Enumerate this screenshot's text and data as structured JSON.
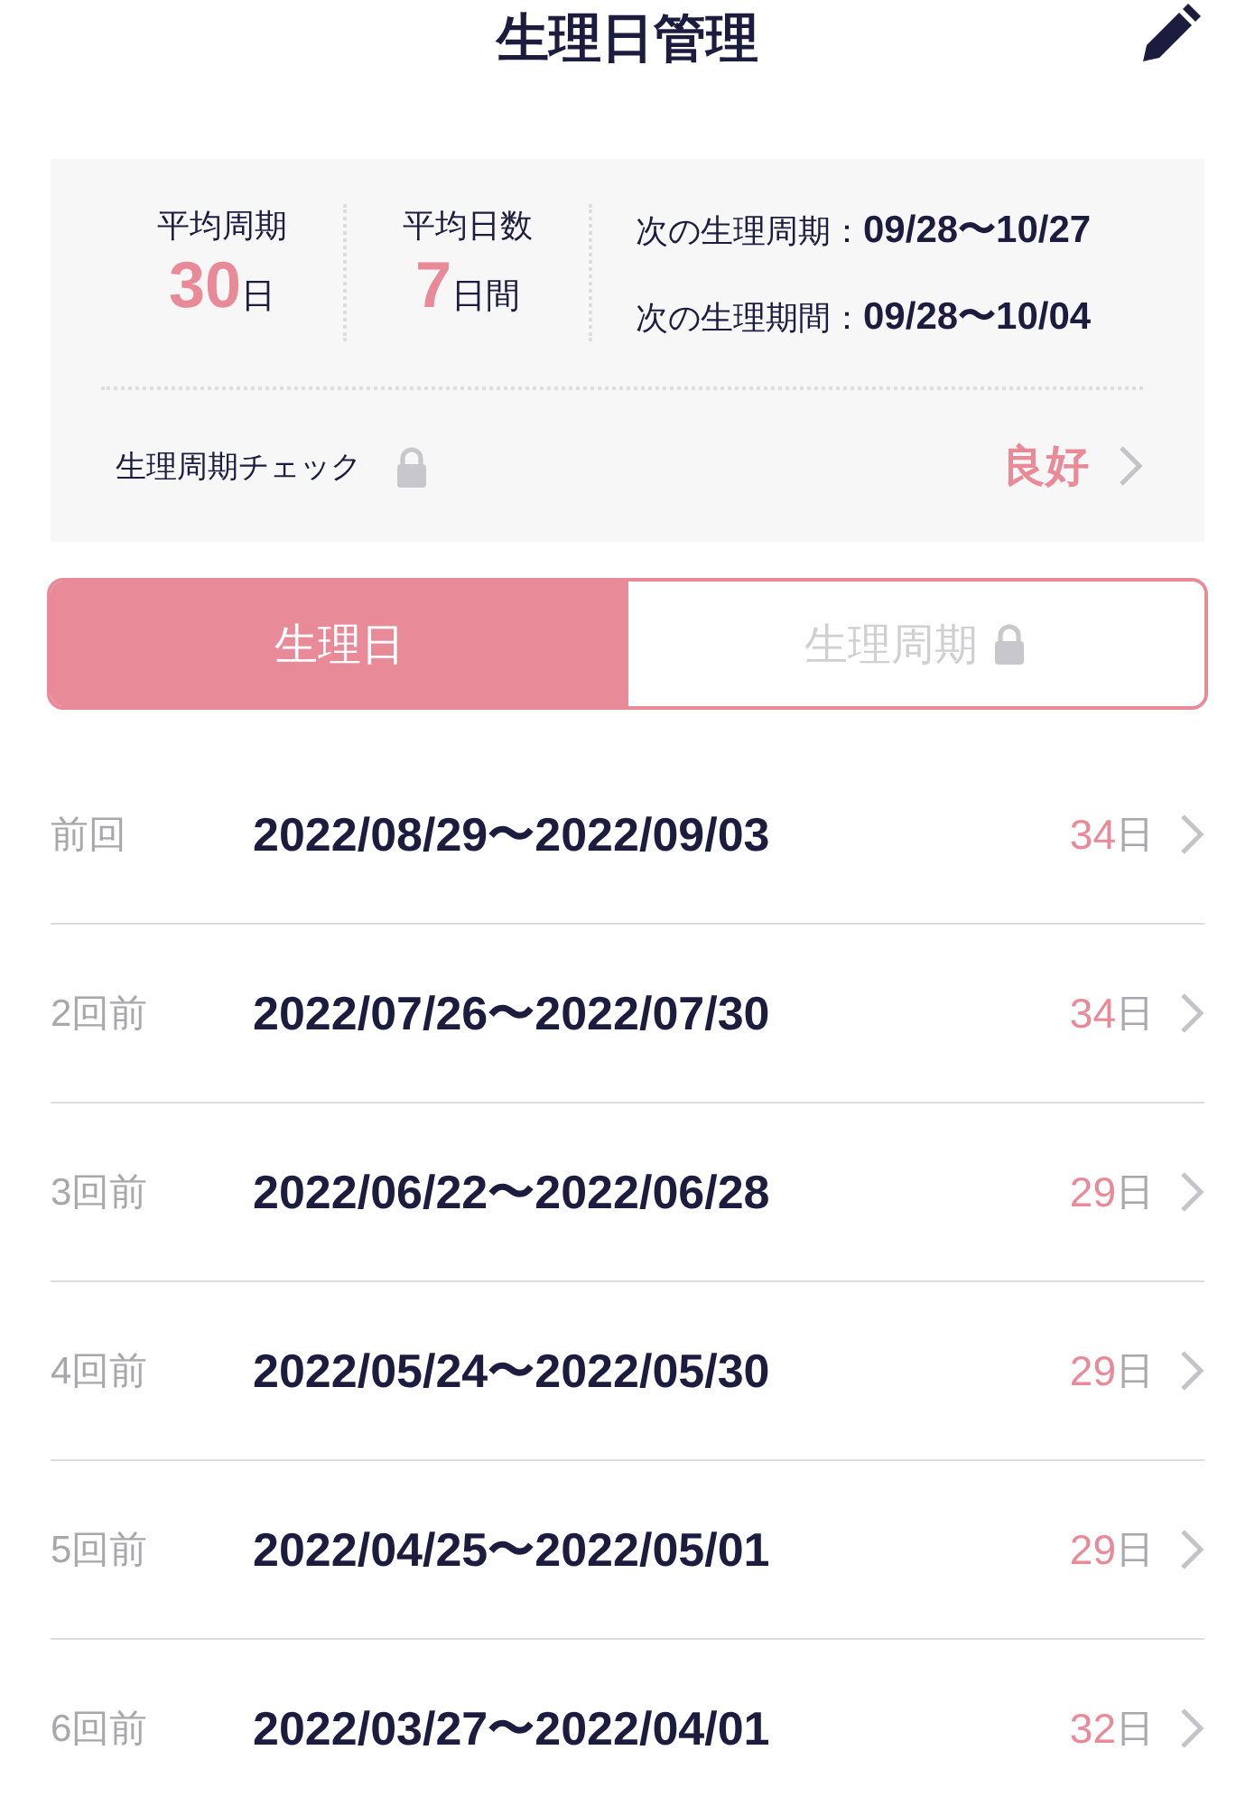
{
  "header": {
    "title": "生理日管理"
  },
  "summary": {
    "stats": [
      {
        "label": "平均周期",
        "value": "30",
        "unit": "日"
      },
      {
        "label": "平均日数",
        "value": "7",
        "unit": "日間"
      }
    ],
    "next": [
      {
        "label": "次の生理周期：",
        "dates": "09/28〜10/27"
      },
      {
        "label": "次の生理期間：",
        "dates": "09/28〜10/04"
      }
    ],
    "check": {
      "label": "生理周期チェック",
      "locked": true,
      "result": "良好"
    }
  },
  "tabs": [
    {
      "label": "生理日",
      "selected": true,
      "locked": false
    },
    {
      "label": "生理周期",
      "selected": false,
      "locked": true
    }
  ],
  "history": [
    {
      "label": "前回",
      "range": "2022/08/29〜2022/09/03",
      "days": "34",
      "unit": "日"
    },
    {
      "label": "2回前",
      "range": "2022/07/26〜2022/07/30",
      "days": "34",
      "unit": "日"
    },
    {
      "label": "3回前",
      "range": "2022/06/22〜2022/06/28",
      "days": "29",
      "unit": "日"
    },
    {
      "label": "4回前",
      "range": "2022/05/24〜2022/05/30",
      "days": "29",
      "unit": "日"
    },
    {
      "label": "5回前",
      "range": "2022/04/25〜2022/05/01",
      "days": "29",
      "unit": "日"
    },
    {
      "label": "6回前",
      "range": "2022/03/27〜2022/04/01",
      "days": "32",
      "unit": "日"
    }
  ]
}
